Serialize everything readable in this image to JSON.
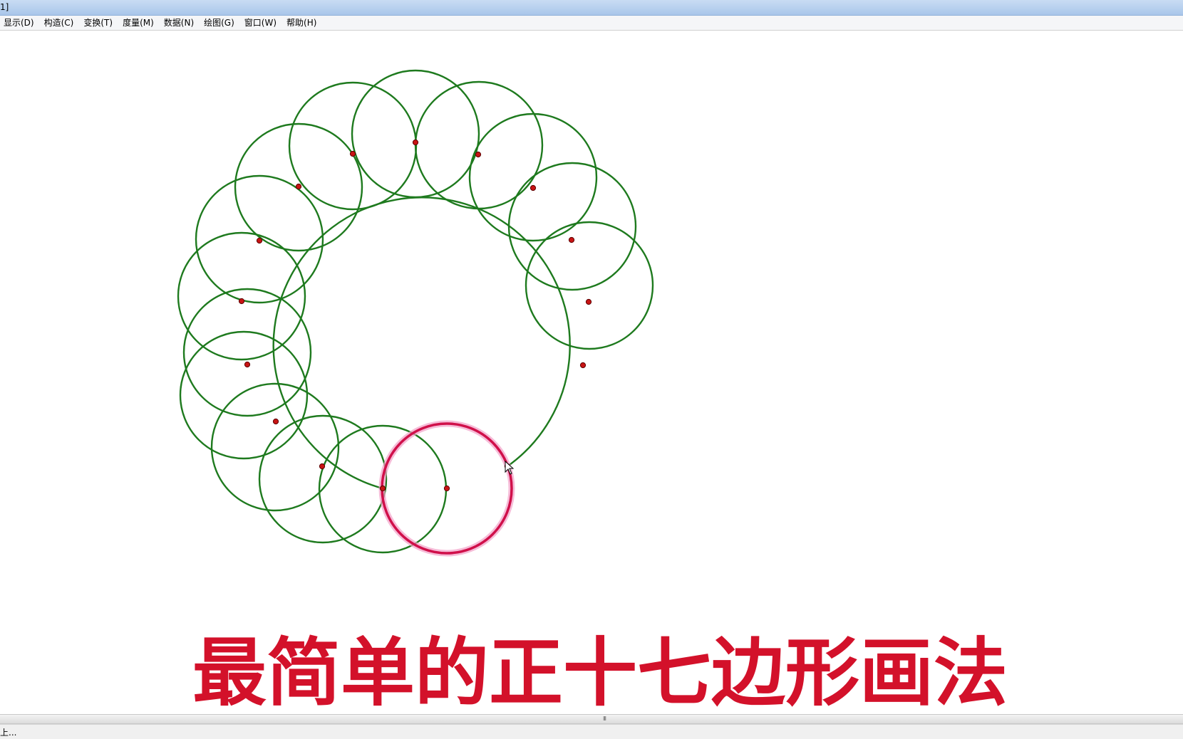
{
  "window": {
    "title": "1]"
  },
  "menu": {
    "items": [
      {
        "label": "显示(D)"
      },
      {
        "label": "构造(C)"
      },
      {
        "label": "变换(T)"
      },
      {
        "label": "度量(M)"
      },
      {
        "label": "数据(N)"
      },
      {
        "label": "绘图(G)"
      },
      {
        "label": "窗口(W)"
      },
      {
        "label": "帮助(H)"
      }
    ]
  },
  "canvas": {
    "headline": "最简单的正十七边形画法",
    "colors": {
      "circle_stroke": "#1e7a1e",
      "highlight_stroke": "#d0104a",
      "highlight_glow": "#f2a0c8",
      "point_fill": "#c81414",
      "headline": "#d3112a"
    },
    "icons": {
      "cursor": "arrow-cursor-icon"
    }
  },
  "scrollbar": {
    "grip": "III"
  },
  "status": {
    "text": "上..."
  }
}
